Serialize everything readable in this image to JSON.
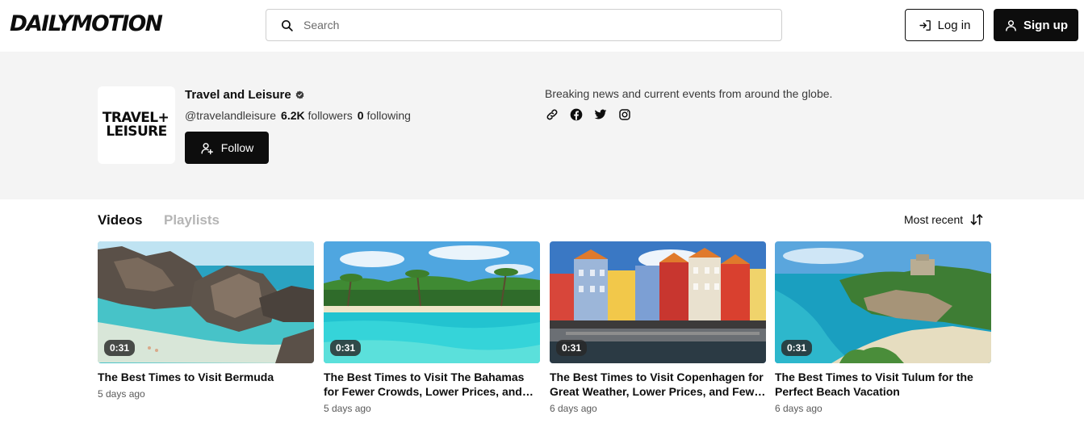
{
  "header": {
    "logo": "DAILYMOTION",
    "search_placeholder": "Search",
    "login_label": "Log in",
    "signup_label": "Sign up"
  },
  "channel": {
    "avatar_line1": "TRAVEL+",
    "avatar_line2": "LEISURE",
    "name": "Travel and Leisure",
    "handle": "@travelandleisure",
    "followers_count": "6.2K",
    "followers_label": "followers",
    "following_count": "0",
    "following_label": "following",
    "follow_label": "Follow",
    "description": "Breaking news and current events from around the globe.",
    "socials": [
      "link-icon",
      "facebook-icon",
      "twitter-icon",
      "instagram-icon"
    ]
  },
  "tabs": {
    "videos": "Videos",
    "playlists": "Playlists",
    "sort_label": "Most recent"
  },
  "videos": [
    {
      "title": "The Best Times to Visit Bermuda",
      "duration": "0:31",
      "date": "5 days ago"
    },
    {
      "title": "The Best Times to Visit The Bahamas for Fewer Crowds, Lower Prices, and More",
      "duration": "0:31",
      "date": "5 days ago"
    },
    {
      "title": "The Best Times to Visit Copenhagen for Great Weather, Lower Prices, and Fewer Crowds",
      "duration": "0:31",
      "date": "6 days ago"
    },
    {
      "title": "The Best Times to Visit Tulum for the Perfect Beach Vacation",
      "duration": "0:31",
      "date": "6 days ago"
    }
  ]
}
